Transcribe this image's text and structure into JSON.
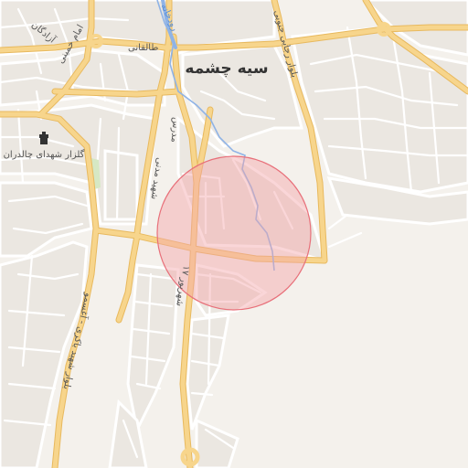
{
  "map": {
    "city_label": "سیه چشمه",
    "colors": {
      "background": "#f4f1ec",
      "block": "#e9e5df",
      "minor_road": "#ffffff",
      "major_road": "#f7d58c",
      "major_road_casing": "#e8b95e",
      "water": "#8fb3e6",
      "park": "#d6e8c4",
      "circle_fill": "#f4a3a8",
      "circle_stroke": "#e8707a"
    },
    "highlight_circle": {
      "fill_opacity": 0.45
    },
    "labels": {
      "river": "رودخانه",
      "azadegan": "آزادگان",
      "taleghani": "طالقانی",
      "imam_khomeini": "امام خمینی",
      "modares": "مدرس",
      "shahid_madani": "شهید مدنی",
      "shahrivar17": "۱۷ شهریور",
      "blvd_rajaei": "بلوار رجایی جنوبی",
      "blvd_bakeri": "بلوار شهید باکری - آغسمو",
      "golzar": "گلزار شهدای چالدران"
    },
    "poi": [
      {
        "name": "golzar-shohada",
        "icon": "monument-icon"
      }
    ]
  }
}
